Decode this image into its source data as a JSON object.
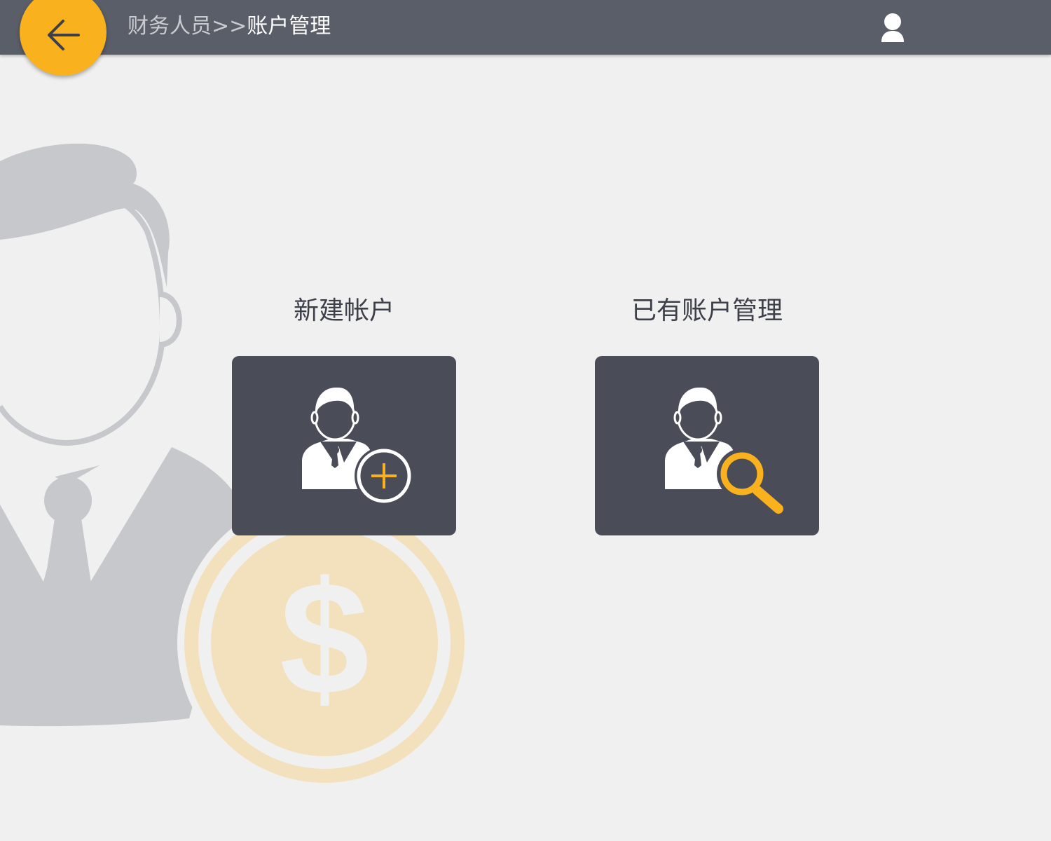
{
  "header": {
    "back_icon": "arrow-left-icon",
    "breadcrumb": {
      "parent": "财务人员",
      "separator": ">>",
      "current": "账户管理"
    },
    "user_icon": "user-icon"
  },
  "options": [
    {
      "label": "新建帐户",
      "icon": "user-add-icon"
    },
    {
      "label": "已有账户管理",
      "icon": "user-search-icon"
    }
  ],
  "colors": {
    "header_bg": "#5a5e69",
    "accent": "#f9b21d",
    "tile_bg": "#4a4c57",
    "page_bg": "#f0f0f0"
  }
}
